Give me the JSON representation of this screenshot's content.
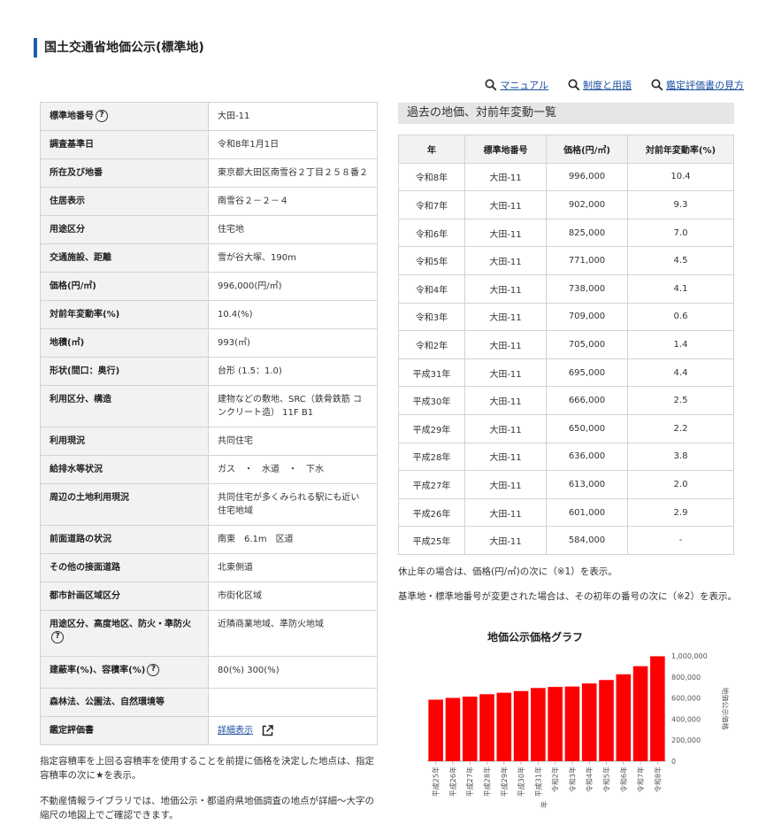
{
  "page_title": "国土交通省地価公示(標準地)",
  "help_links": [
    {
      "label": "マニュアル"
    },
    {
      "label": "制度と用語"
    },
    {
      "label": "鑑定評価書の見方"
    }
  ],
  "detail": {
    "rows": [
      {
        "key": "標準地番号",
        "value": "大田-11",
        "help": true
      },
      {
        "key": "調査基準日",
        "value": "令和8年1月1日"
      },
      {
        "key": "所在及び地番",
        "value": "東京都大田区南雪谷２丁目２５８番２"
      },
      {
        "key": "住居表示",
        "value": "南雪谷２－２－４"
      },
      {
        "key": "用途区分",
        "value": "住宅地"
      },
      {
        "key": "交通施設、距離",
        "value": "雪が谷大塚、190m"
      },
      {
        "key": "価格(円/㎡)",
        "value": "996,000(円/㎡)"
      },
      {
        "key": "対前年変動率(%)",
        "value": "10.4(%)"
      },
      {
        "key": "地積(㎡)",
        "value": "993(㎡)"
      },
      {
        "key": "形状(間口：奥行)",
        "value": "台形 (1.5：1.0)"
      },
      {
        "key": "利用区分、構造",
        "value": "建物などの敷地、SRC（鉄骨鉄筋 コンクリート造） 11F B1"
      },
      {
        "key": "利用現況",
        "value": "共同住宅"
      },
      {
        "key": "給排水等状況",
        "value": "ガス　・　水道　・　下水"
      },
      {
        "key": "周辺の土地利用現況",
        "value": "共同住宅が多くみられる駅にも近い住宅地域"
      },
      {
        "key": "前面道路の状況",
        "value": "南東　6.1m　区道"
      },
      {
        "key": "その他の接面道路",
        "value": "北東側道"
      },
      {
        "key": "都市計画区域区分",
        "value": "市街化区域"
      },
      {
        "key": "用途区分、高度地区、防火・準防火",
        "value": "近隣商業地域、準防火地域",
        "help": true
      },
      {
        "key": "建蔽率(%)、容積率(%)",
        "value": "80(%) 300(%)",
        "help": true
      },
      {
        "key": "森林法、公園法、自然環境等",
        "value": ""
      },
      {
        "key": "鑑定評価書",
        "value": "詳細表示",
        "link": true
      }
    ],
    "help_mark": "?"
  },
  "notes_left": [
    "指定容積率を上回る容積率を使用することを前提に価格を決定した地点は、指定容積率の次に★を表示。",
    "不動産情報ライブラリでは、地価公示・都道府県地価調査の地点が詳細〜大字の縮尺の地図上でご確認できます。"
  ],
  "history": {
    "title": "過去の地価、対前年変動一覧",
    "headers": [
      "年",
      "標準地番号",
      "価格(円/㎡)",
      "対前年変動率(%)"
    ],
    "rows": [
      [
        "令和8年",
        "大田-11",
        "996,000",
        "10.4"
      ],
      [
        "令和7年",
        "大田-11",
        "902,000",
        "9.3"
      ],
      [
        "令和6年",
        "大田-11",
        "825,000",
        "7.0"
      ],
      [
        "令和5年",
        "大田-11",
        "771,000",
        "4.5"
      ],
      [
        "令和4年",
        "大田-11",
        "738,000",
        "4.1"
      ],
      [
        "令和3年",
        "大田-11",
        "709,000",
        "0.6"
      ],
      [
        "令和2年",
        "大田-11",
        "705,000",
        "1.4"
      ],
      [
        "平成31年",
        "大田-11",
        "695,000",
        "4.4"
      ],
      [
        "平成30年",
        "大田-11",
        "666,000",
        "2.5"
      ],
      [
        "平成29年",
        "大田-11",
        "650,000",
        "2.2"
      ],
      [
        "平成28年",
        "大田-11",
        "636,000",
        "3.8"
      ],
      [
        "平成27年",
        "大田-11",
        "613,000",
        "2.0"
      ],
      [
        "平成26年",
        "大田-11",
        "601,000",
        "2.9"
      ],
      [
        "平成25年",
        "大田-11",
        "584,000",
        "-"
      ]
    ]
  },
  "notes_right": [
    "休止年の場合は、価格(円/㎡)の次に（※1）を表示。",
    "基準地・標準地番号が変更された場合は、その初年の番号の次に（※2）を表示。"
  ],
  "chart_data": {
    "type": "bar",
    "title": "地価公示価格グラフ",
    "xlabel": "年",
    "ylabel": "地価公示価格",
    "categories": [
      "平成25年",
      "平成26年",
      "平成27年",
      "平成28年",
      "平成29年",
      "平成30年",
      "平成31年",
      "令和2年",
      "令和3年",
      "令和4年",
      "令和5年",
      "令和6年",
      "令和7年",
      "令和8年"
    ],
    "values": [
      584000,
      601000,
      613000,
      636000,
      650000,
      666000,
      695000,
      705000,
      709000,
      738000,
      771000,
      825000,
      902000,
      996000
    ],
    "ylim": [
      0,
      1000000
    ],
    "yticks": [
      "0",
      "200,000",
      "400,000",
      "600,000",
      "800,000",
      "1,000,000"
    ],
    "bar_color": "#ff0000",
    "grid": false
  }
}
